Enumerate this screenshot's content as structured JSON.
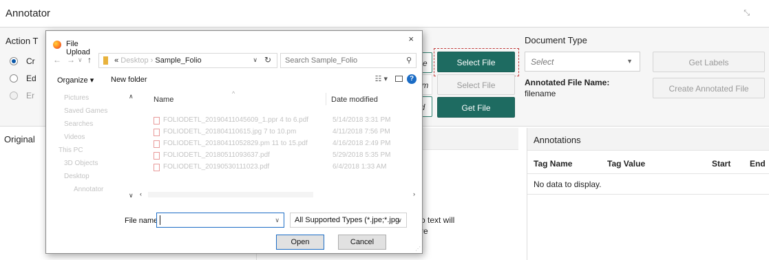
{
  "app": {
    "title": "Annotator"
  },
  "action": {
    "label": "Action T",
    "options": [
      "Cr",
      "Ed",
      "Er"
    ]
  },
  "buttons": {
    "partial_name_btn": "ne",
    "partial_name2_btn": "am",
    "partial_d_btn": "d",
    "select_file_primary": "Select File",
    "select_file_secondary": "Select File",
    "get_file": "Get File"
  },
  "document": {
    "type_label": "Document Type",
    "select_placeholder": "Select",
    "get_labels": "Get Labels",
    "annotated_file_name_label": "Annotated File Name:",
    "annotated_file_name_value": "filename",
    "create_annotated_file": "Create Annotated File"
  },
  "panels": {
    "original_title": "Original",
    "mid_text_line1": "o text will",
    "mid_text_line2": "re"
  },
  "annotations": {
    "title": "Annotations",
    "columns": [
      "Tag Name",
      "Tag Value",
      "Start",
      "End"
    ],
    "empty_text": "No data to display."
  },
  "dialog": {
    "title": "File Upload",
    "close_label": "×",
    "address": {
      "prefix": "«",
      "dim_crumb": "Desktop",
      "sep": "›",
      "current": "Sample_Folio"
    },
    "search_placeholder": "Search Sample_Folio",
    "toolbar": {
      "organize": "Organize ▾",
      "new_folder": "New folder",
      "help": "?"
    },
    "nav_items": [
      "Pictures",
      "Saved Games",
      "Searches",
      "Videos",
      "This PC",
      "3D Objects",
      "Desktop",
      "Annotator"
    ],
    "columns": {
      "name": "Name",
      "date": "Date modified"
    },
    "files": [
      {
        "name": "FOLIODETL_20190411045609_1.ppr 4 to 6.pdf",
        "date": "5/14/2018 3:31 PM"
      },
      {
        "name": "FOLIODETL_201804110615.jpg 7 to 10.pm",
        "date": "4/11/2018 7:56 PM"
      },
      {
        "name": "FOLIODETL_20180411052829.pm 11 to 15.pdf",
        "date": "4/16/2018 2:49 PM"
      },
      {
        "name": "FOLIODETL_20180511093637.pdf",
        "date": "5/29/2018 5:35 PM"
      },
      {
        "name": "FOLIODETL_20190530111023.pdf",
        "date": "6/4/2018 1:33 AM"
      }
    ],
    "file_name_label": "File name:",
    "file_name_value": "",
    "file_type": "All Supported Types (*.jpe;*.jpg",
    "open": "Open",
    "cancel": "Cancel"
  },
  "colors": {
    "accent_teal": "#1e6b61",
    "highlight_red": "#c23b3b",
    "dialog_blue": "#1b6cc5"
  }
}
